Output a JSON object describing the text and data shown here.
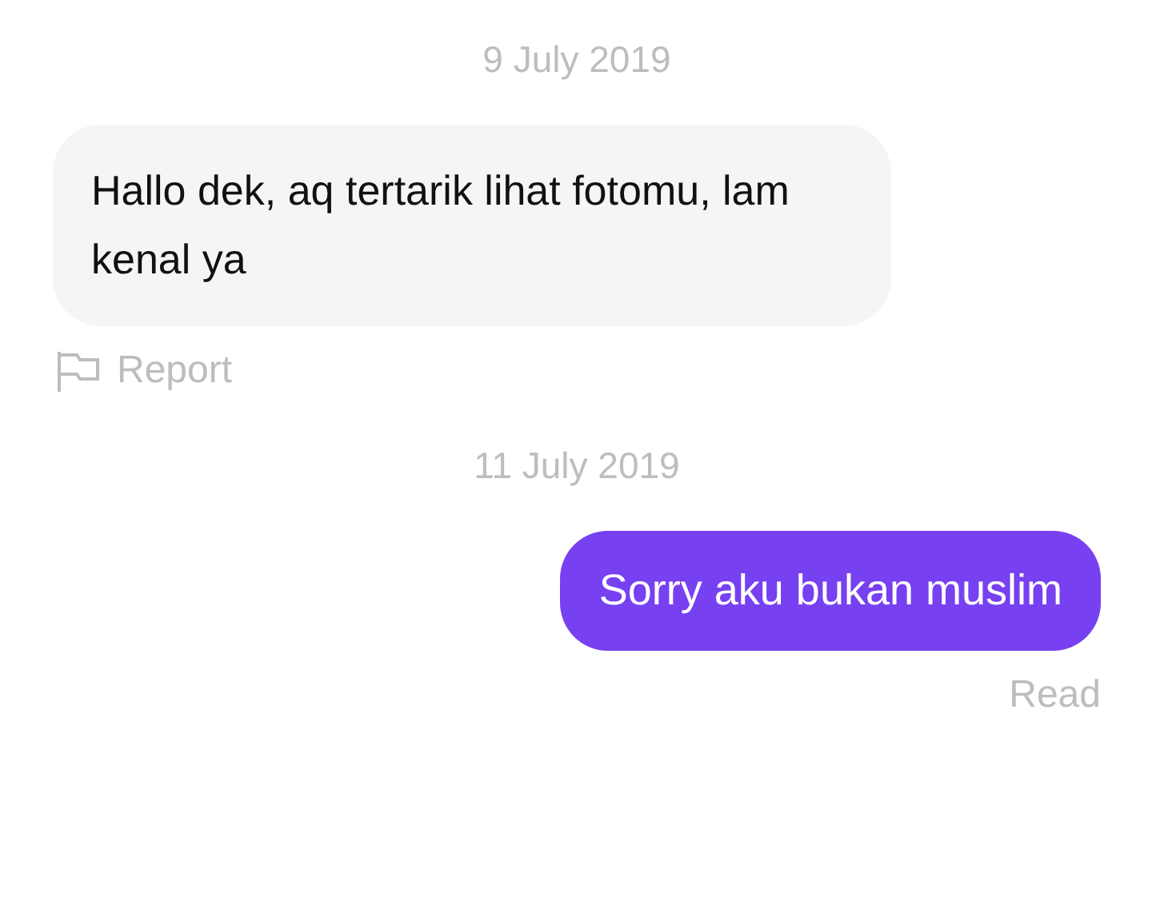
{
  "messages": [
    {
      "kind": "date",
      "text": "9 July 2019"
    },
    {
      "kind": "incoming",
      "text": "Hallo dek, aq tertarik lihat fotomu, lam kenal ya",
      "action": "Report"
    },
    {
      "kind": "date",
      "text": "11 July 2019"
    },
    {
      "kind": "outgoing",
      "text": "Sorry aku bukan muslim",
      "status": "Read"
    }
  ]
}
